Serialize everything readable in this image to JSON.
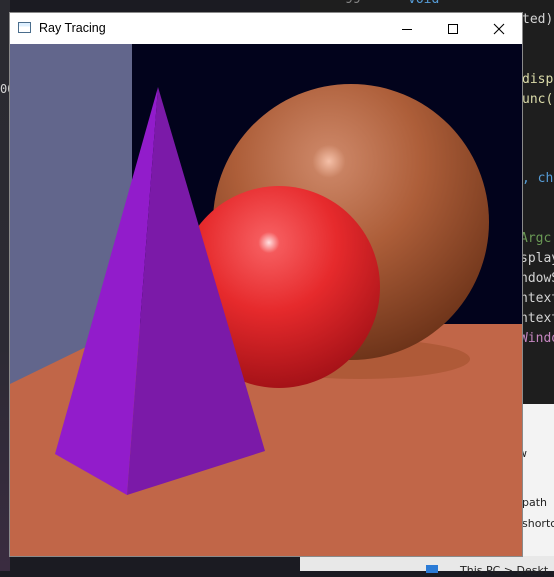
{
  "window": {
    "title": "Ray Tracing",
    "minimize_icon": "minimize-icon",
    "maximize_icon": "maximize-icon",
    "close_icon": "close-icon"
  },
  "scene": {
    "colors": {
      "sky": "#02031c",
      "wall": "#62668c",
      "floor": "#c16648",
      "pyramid_left": "#921ccb",
      "pyramid_right": "#7b1aa8",
      "red_sphere": "#e8262a",
      "copper_sphere": "#b06138"
    }
  },
  "background": {
    "line_number": "99",
    "left_fragment": "00",
    "code_lines": [
      "void",
      "ted)",
      "displ",
      "unc(",
      ", ch",
      "Argc",
      "splay",
      "ndowS",
      "ntext",
      "ntext",
      "Windo"
    ],
    "explorer_items": [
      "w",
      "path",
      "shortc",
      "This PC > Deskt"
    ]
  }
}
